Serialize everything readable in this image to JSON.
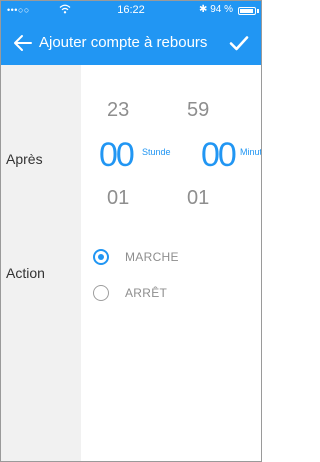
{
  "status_bar": {
    "signal": "•••○○",
    "time": "16:22",
    "battery_text": "✱ 94 %",
    "battery_level": 0.94
  },
  "app_bar": {
    "title": "Ajouter compte à rebours",
    "back_icon": "arrow-left-icon",
    "confirm_icon": "check-icon"
  },
  "form": {
    "after_label": "Après",
    "action_label": "Action"
  },
  "picker": {
    "hour_prev": "23",
    "hour_selected": "00",
    "hour_next": "01",
    "hour_unit": "Stunde",
    "minute_prev": "59",
    "minute_selected": "00",
    "minute_next": "01",
    "minute_unit": "Minute"
  },
  "actions": [
    {
      "label": "MARCHE",
      "checked": true
    },
    {
      "label": "ARRÊT",
      "checked": false
    }
  ],
  "colors": {
    "primary": "#2196f3",
    "side_panel": "#f1f1f1",
    "muted_text": "#8e8e8e"
  }
}
